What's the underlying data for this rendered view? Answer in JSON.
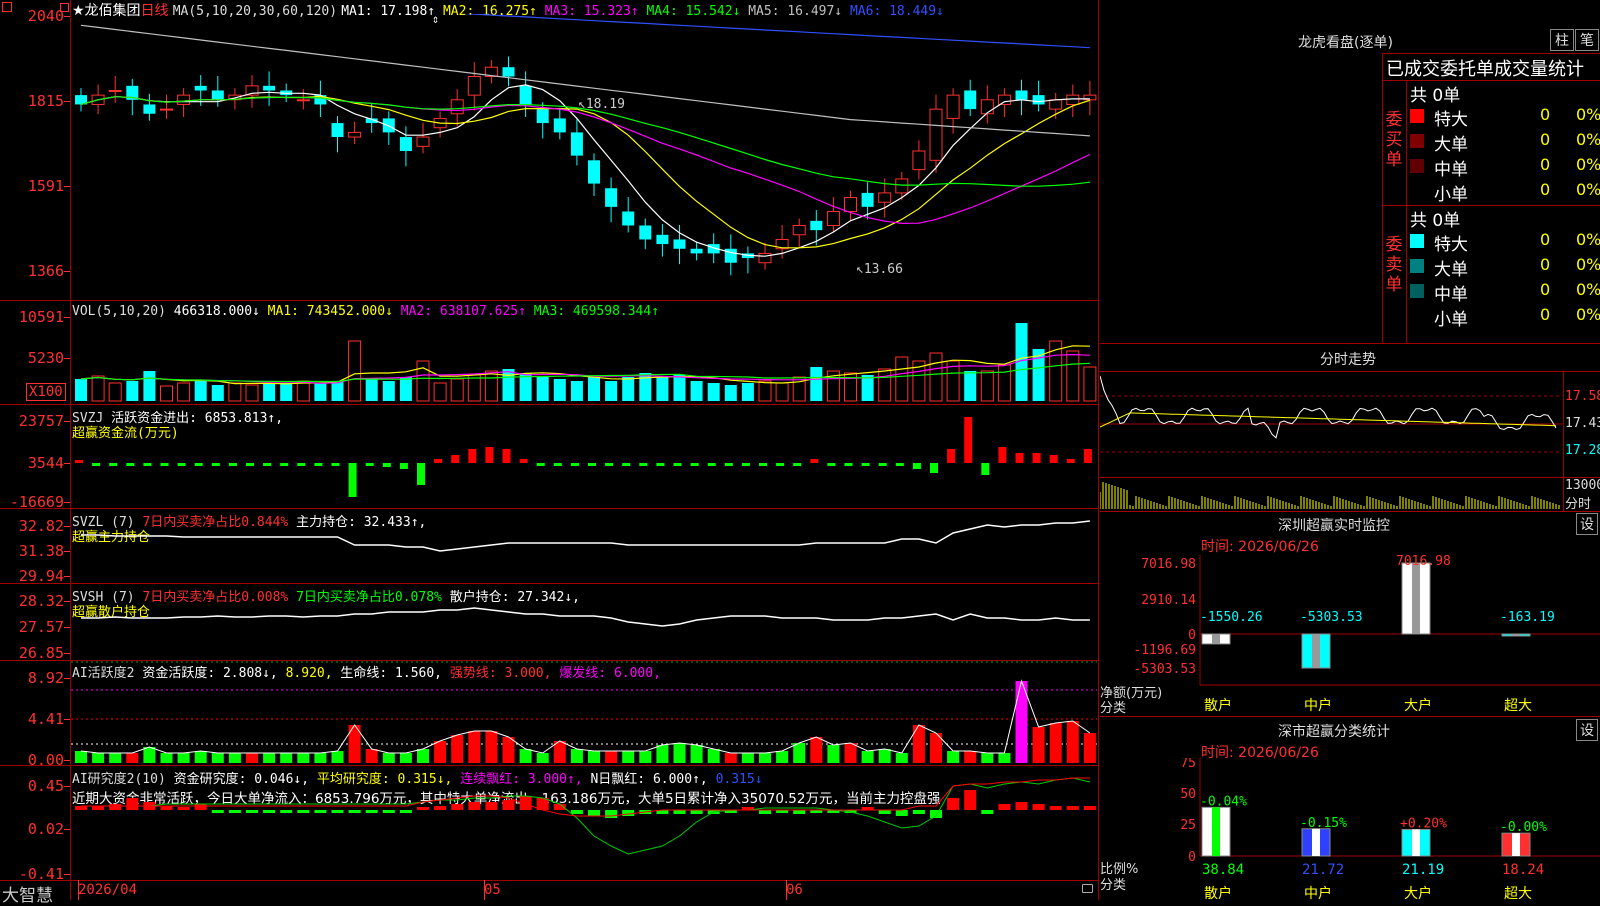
{
  "app": {
    "name": "大智慧"
  },
  "kline": {
    "title": "★龙佰集团",
    "period": "日线",
    "ma_label": "MA(5,10,20,30,60,120)",
    "ma": [
      {
        "label": "MA1: 17.198↑",
        "color": "#ffffff"
      },
      {
        "label": "MA2: 16.275↑",
        "color": "#ffff00"
      },
      {
        "label": "MA3: 15.323↑",
        "color": "#ff00ff"
      },
      {
        "label": "MA4: 15.542↓",
        "color": "#00ff00"
      },
      {
        "label": "MA5: 16.497↓",
        "color": "#c0c0c0"
      },
      {
        "label": "MA6: 18.449↓",
        "color": "#3050ff"
      }
    ],
    "yaxis": [
      "2040",
      "1815",
      "1591",
      "1366"
    ],
    "high_label": "18.19",
    "low_label": "13.66"
  },
  "vol": {
    "label": "VOL(5,10,20)",
    "value": "466318.000↓",
    "ma1": "MA1: 743452.000↓",
    "ma2": "MA2: 638107.625↑",
    "ma3": "MA3: 469598.344↑",
    "yaxis": [
      "10591",
      "5230"
    ],
    "unit": "X100"
  },
  "svzj": {
    "label": "SVZJ",
    "desc": "活跃资金进出: 6853.813↑,",
    "sub": "超赢资金流(万元)",
    "yaxis": [
      "23757",
      "3544",
      "-16669"
    ]
  },
  "svzl": {
    "label": "SVZL (7)",
    "desc1": "7日内买卖净占比0.844%",
    "desc2": "主力持仓: 32.433↑,",
    "sub": "超赢主力持仓",
    "yaxis": [
      "32.82",
      "31.38",
      "29.94"
    ]
  },
  "svsh": {
    "label": "SVSH (7)",
    "desc1": "7日内买卖净占比0.008%",
    "desc2": "7日内买卖净占比0.078%",
    "desc3": "散户持仓: 27.342↓,",
    "sub": "超赢散户持仓",
    "yaxis": [
      "28.32",
      "27.57",
      "26.85"
    ]
  },
  "ai1": {
    "label": "AI活跃度2",
    "v1": "资金活跃度: 2.808↓,",
    "v2": "8.920,",
    "v3": "生命线: 1.560,",
    "v4": "强势线: 3.000,",
    "v5": "爆发线: 6.000,",
    "yaxis": [
      "8.92",
      "4.41",
      "0.00"
    ]
  },
  "ai2": {
    "label": "AI研究度2(10)",
    "v1": "资金研究度: 0.046↓,",
    "v2": "平均研究度: 0.315↓,",
    "v3": "连续飘红: 3.000↑,",
    "v4": "N日飘红: 6.000↑,",
    "v5": "0.315↓",
    "note": "近期大资金非常活跃，今日大单净流入：6853.796万元，其中特大单净流出: -163.186万元，大单5日累计净入35070.52万元，当前主力控盘强",
    "yaxis": [
      "0.45",
      "0.02",
      "-0.41"
    ]
  },
  "xaxis": [
    "2026/04",
    "05",
    "06"
  ],
  "right": {
    "lhb_title": "龙虎看盘(逐单)",
    "btn_zhu": "柱",
    "btn_bi": "笔",
    "stats_title": "已成交委托单成交量统计",
    "buy_side": "委买单",
    "sell_side": "委卖单",
    "buy_total": "共 0单",
    "sell_total": "共 0单",
    "buy_rows": [
      {
        "name": "特大",
        "count": "0",
        "pct": "0%",
        "color": "#ff0000"
      },
      {
        "name": "大单",
        "count": "0",
        "pct": "0%",
        "color": "#800000"
      },
      {
        "name": "中单",
        "count": "0",
        "pct": "0%",
        "color": "#600000"
      },
      {
        "name": "小单",
        "count": "0",
        "pct": "0%",
        "color": "#000000"
      }
    ],
    "sell_rows": [
      {
        "name": "特大",
        "count": "0",
        "pct": "0%",
        "color": "#00ffff"
      },
      {
        "name": "大单",
        "count": "0",
        "pct": "0%",
        "color": "#008080"
      },
      {
        "name": "中单",
        "count": "0",
        "pct": "0%",
        "color": "#006060"
      },
      {
        "name": "小单",
        "count": "0",
        "pct": "0%",
        "color": "#000000"
      }
    ],
    "fenshi_title": "分时走势",
    "fenshi_yaxis": [
      "17.58",
      "17.43",
      "17.28"
    ],
    "fenshi_vol": "13000",
    "fenshi_unit": "分时",
    "sz_monitor": {
      "title": "深圳超赢实时监控",
      "settings": "设",
      "time": "时间: 2026/06/26",
      "yaxis": [
        "7016.98",
        "2910.14",
        "0",
        "-1196.69",
        "-5303.53"
      ],
      "ylabel": "净额(万元)",
      "xlabel": "分类",
      "cats": [
        "散户",
        "中户",
        "大户",
        "超大"
      ],
      "values": [
        "-1550.26",
        "-5303.53",
        "7016.98",
        "-163.19"
      ]
    },
    "sz_stats": {
      "title": "深市超赢分类统计",
      "settings": "设",
      "time": "时间: 2026/06/26",
      "yaxis": [
        "75",
        "50",
        "25",
        "0"
      ],
      "ylabel": "比例%",
      "xlabel": "分类",
      "cats": [
        "散户",
        "中户",
        "大户",
        "超大"
      ],
      "values": [
        "38.84",
        "21.72",
        "21.19",
        "18.24"
      ],
      "changes": [
        "-0.04%",
        "-0.15%",
        "+0.20%",
        "-0.00%"
      ]
    }
  }
}
